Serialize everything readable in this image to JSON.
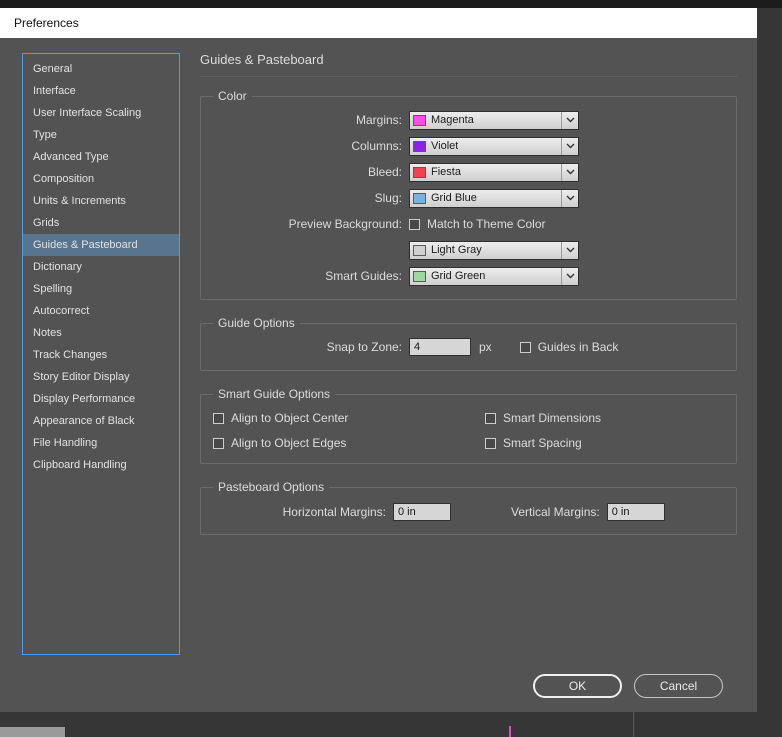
{
  "window": {
    "title": "Preferences"
  },
  "sidebar": {
    "items": [
      "General",
      "Interface",
      "User Interface Scaling",
      "Type",
      "Advanced Type",
      "Composition",
      "Units & Increments",
      "Grids",
      "Guides & Pasteboard",
      "Dictionary",
      "Spelling",
      "Autocorrect",
      "Notes",
      "Track Changes",
      "Story Editor Display",
      "Display Performance",
      "Appearance of Black",
      "File Handling",
      "Clipboard Handling"
    ],
    "selected": "Guides & Pasteboard"
  },
  "panel": {
    "title": "Guides & Pasteboard",
    "color": {
      "title": "Color",
      "margins": {
        "label": "Margins:",
        "value": "Magenta",
        "swatch": "#f251e1"
      },
      "columns": {
        "label": "Columns:",
        "value": "Violet",
        "swatch": "#8d22e5"
      },
      "bleed": {
        "label": "Bleed:",
        "value": "Fiesta",
        "swatch": "#ef4352"
      },
      "slug": {
        "label": "Slug:",
        "value": "Grid Blue",
        "swatch": "#79b3de"
      },
      "preview_background": {
        "label": "Preview Background:",
        "checkbox": "Match to Theme Color",
        "checked": false
      },
      "preview_color": {
        "value": "Light Gray",
        "swatch": "#cfcfcf"
      },
      "smart_guides": {
        "label": "Smart Guides:",
        "value": "Grid Green",
        "swatch": "#9ed8a0"
      }
    },
    "guide_options": {
      "title": "Guide Options",
      "snap_label": "Snap to Zone:",
      "snap_value": "4",
      "unit": "px",
      "guides_in_back": "Guides in Back",
      "guides_in_back_checked": false
    },
    "smart_guide_options": {
      "title": "Smart Guide Options",
      "options": [
        {
          "label": "Align to Object Center",
          "checked": false
        },
        {
          "label": "Smart Dimensions",
          "checked": false
        },
        {
          "label": "Align to Object Edges",
          "checked": false
        },
        {
          "label": "Smart Spacing",
          "checked": false
        }
      ]
    },
    "pasteboard_options": {
      "title": "Pasteboard Options",
      "horizontal_label": "Horizontal Margins:",
      "horizontal_value": "0 in",
      "vertical_label": "Vertical Margins:",
      "vertical_value": "0 in"
    }
  },
  "buttons": {
    "ok": "OK",
    "cancel": "Cancel"
  }
}
